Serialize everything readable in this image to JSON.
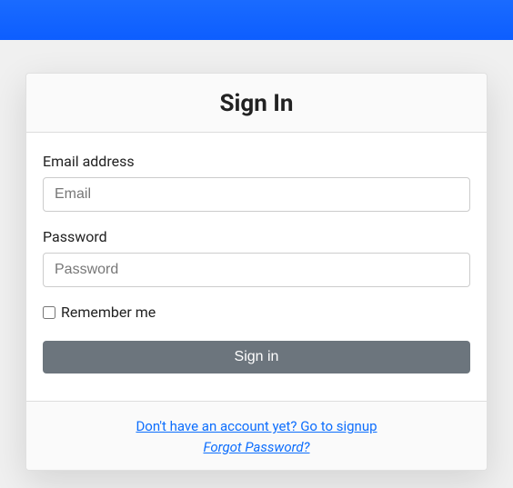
{
  "header": {
    "title": "Sign In"
  },
  "form": {
    "email": {
      "label": "Email address",
      "placeholder": "Email",
      "value": ""
    },
    "password": {
      "label": "Password",
      "placeholder": "Password",
      "value": ""
    },
    "remember": {
      "label": "Remember me",
      "checked": false
    },
    "submit_label": "Sign in"
  },
  "footer": {
    "signup_link": "Don't have an account yet? Go to signup",
    "forgot_link": "Forgot Password?"
  }
}
